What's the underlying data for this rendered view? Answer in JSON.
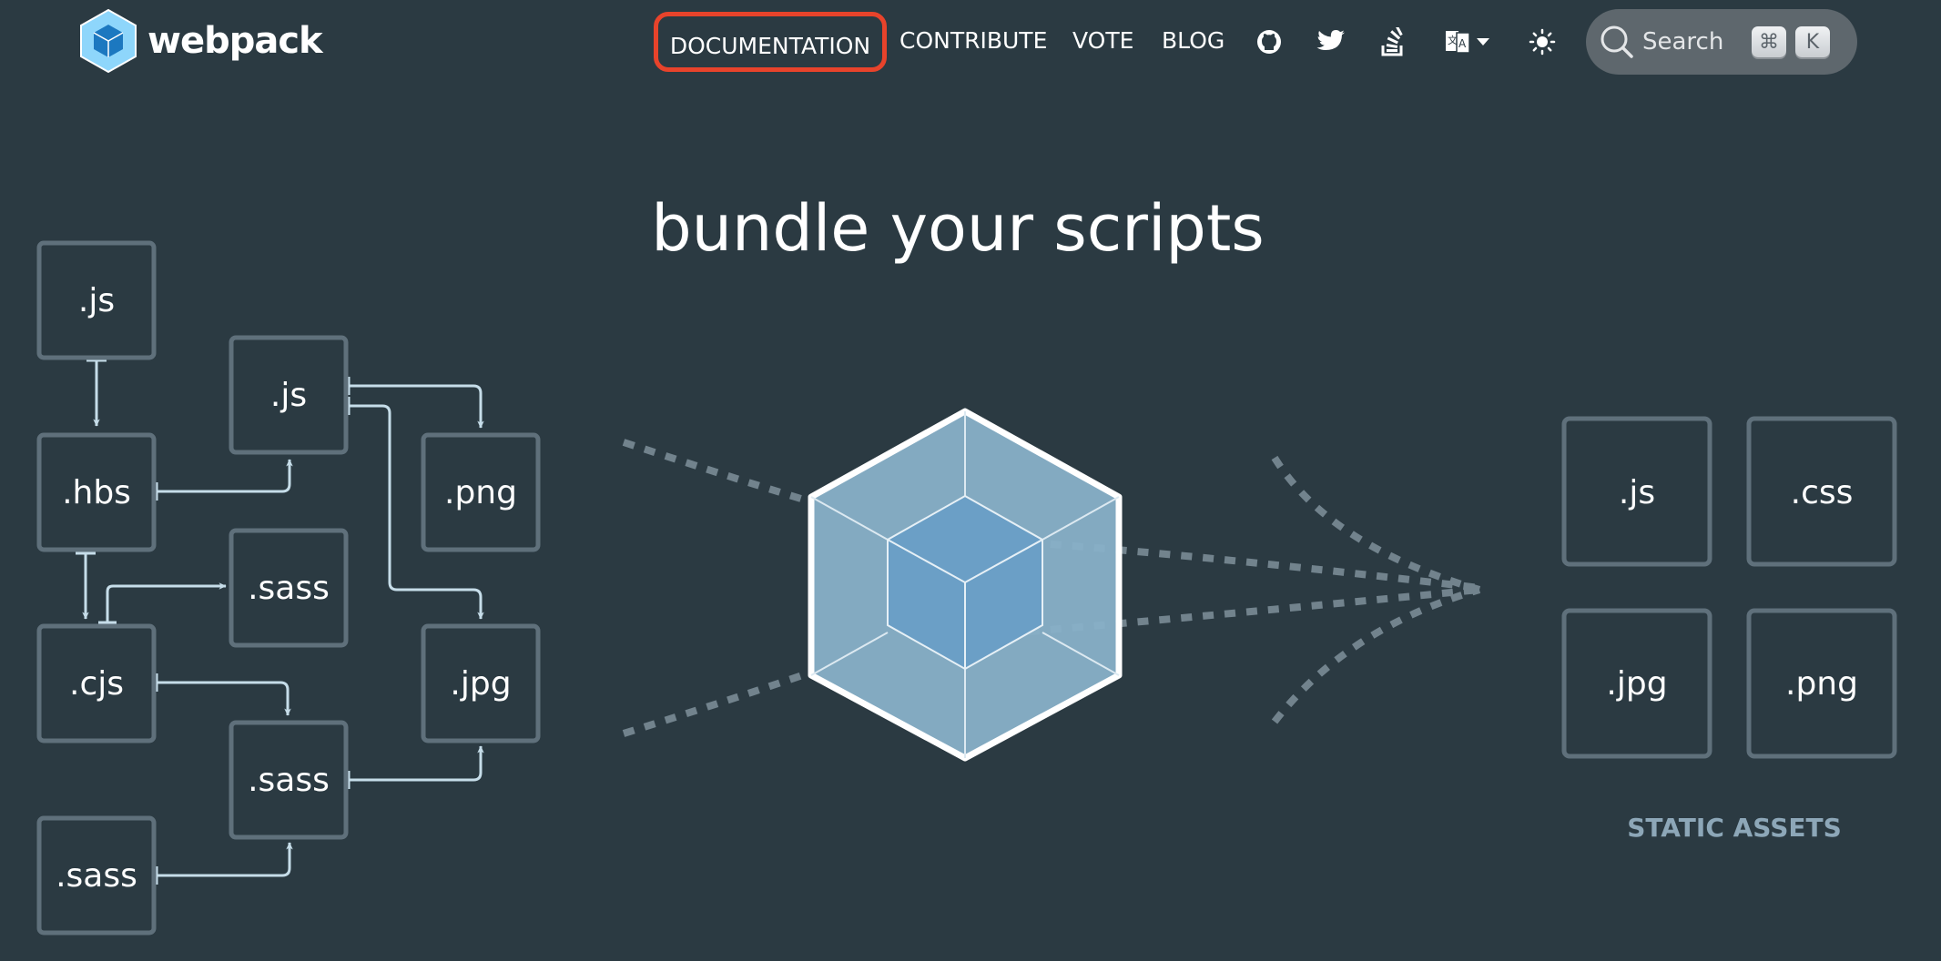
{
  "header": {
    "logo_text": "webpack",
    "nav": {
      "documentation": "DOCUMENTATION",
      "contribute": "CONTRIBUTE",
      "vote": "VOTE",
      "blog": "BLOG"
    },
    "icons": [
      "github-icon",
      "twitter-icon",
      "stackoverflow-icon",
      "language-icon",
      "theme-sun-icon",
      "search-icon"
    ],
    "search": {
      "label": "Search",
      "shortcut_modifier": "⌘",
      "shortcut_key": "K"
    }
  },
  "hero": {
    "title": "bundle your scripts",
    "source_files": [
      ".js",
      ".js",
      ".hbs",
      ".png",
      ".sass",
      ".cjs",
      ".jpg",
      ".sass",
      ".sass"
    ],
    "output_files": [
      ".js",
      ".css",
      ".jpg",
      ".png"
    ],
    "output_caption": "STATIC ASSETS"
  },
  "colors": {
    "background": "#2b3a42",
    "box_border": "#5f707b",
    "arrow": "#c6dde9",
    "highlight": "#e8432b",
    "cube_outer": "#8ab0c8",
    "cube_inner": "#6b9fc6",
    "caption": "#8da7b8"
  }
}
